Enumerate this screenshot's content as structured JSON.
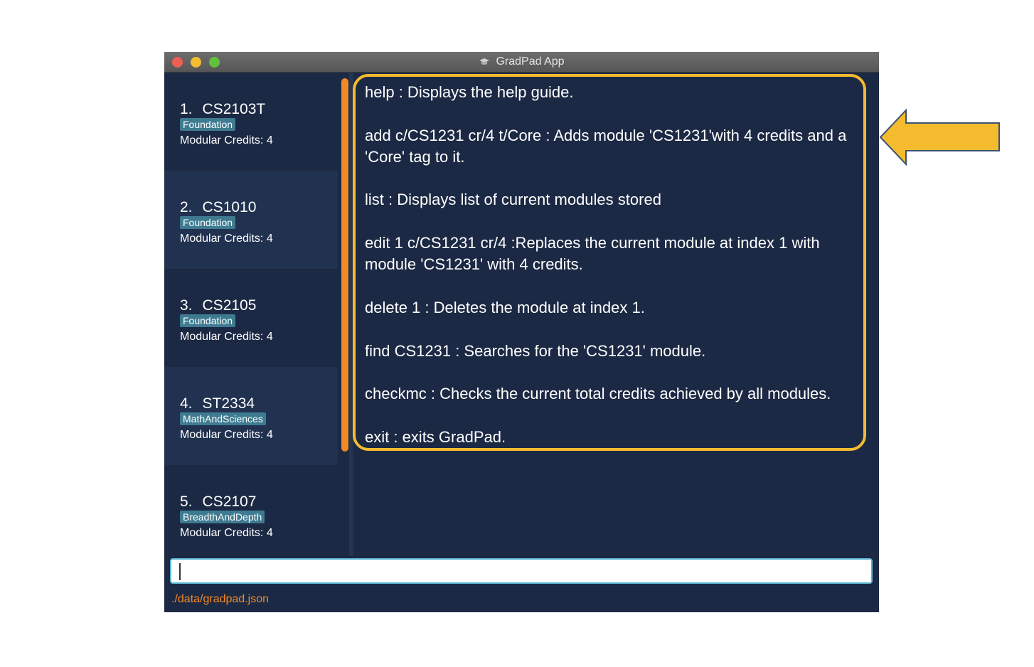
{
  "window": {
    "title": "GradPad App"
  },
  "modules": [
    {
      "index": "1.",
      "code": "CS2103T",
      "tag": "Foundation",
      "credits": "Modular Credits: 4"
    },
    {
      "index": "2.",
      "code": "CS1010",
      "tag": "Foundation",
      "credits": "Modular Credits: 4"
    },
    {
      "index": "3.",
      "code": "CS2105",
      "tag": "Foundation",
      "credits": "Modular Credits: 4"
    },
    {
      "index": "4.",
      "code": "ST2334",
      "tag": "MathAndSciences",
      "credits": "Modular Credits: 4"
    },
    {
      "index": "5.",
      "code": "CS2107",
      "tag": "BreadthAndDepth",
      "credits": "Modular Credits: 4"
    }
  ],
  "result_lines": [
    "help : Displays the help guide.",
    "add c/CS1231 cr/4 t/Core : Adds module 'CS1231'with 4 credits and a 'Core' tag to it.",
    "list : Displays list of current modules stored",
    "edit 1 c/CS1231 cr/4 :Replaces the current module at index 1 with module 'CS1231' with 4 credits.",
    "delete 1 : Deletes the module at index 1.",
    "find CS1231 : Searches for the 'CS1231' module.",
    "checkmc : Checks the current total credits achieved by all modules.",
    "exit : exits GradPad."
  ],
  "command_box": {
    "value": ""
  },
  "status_bar": {
    "path": "./data/gradpad.json"
  },
  "colors": {
    "background": "#1c2944",
    "highlight_border": "#f5bb2f",
    "arrow": "#f5bb2f",
    "tag": "#3e7b91",
    "status": "#f08a27"
  },
  "icons": {
    "title": "graduation-cap-icon",
    "annotation": "arrow-left-icon"
  }
}
